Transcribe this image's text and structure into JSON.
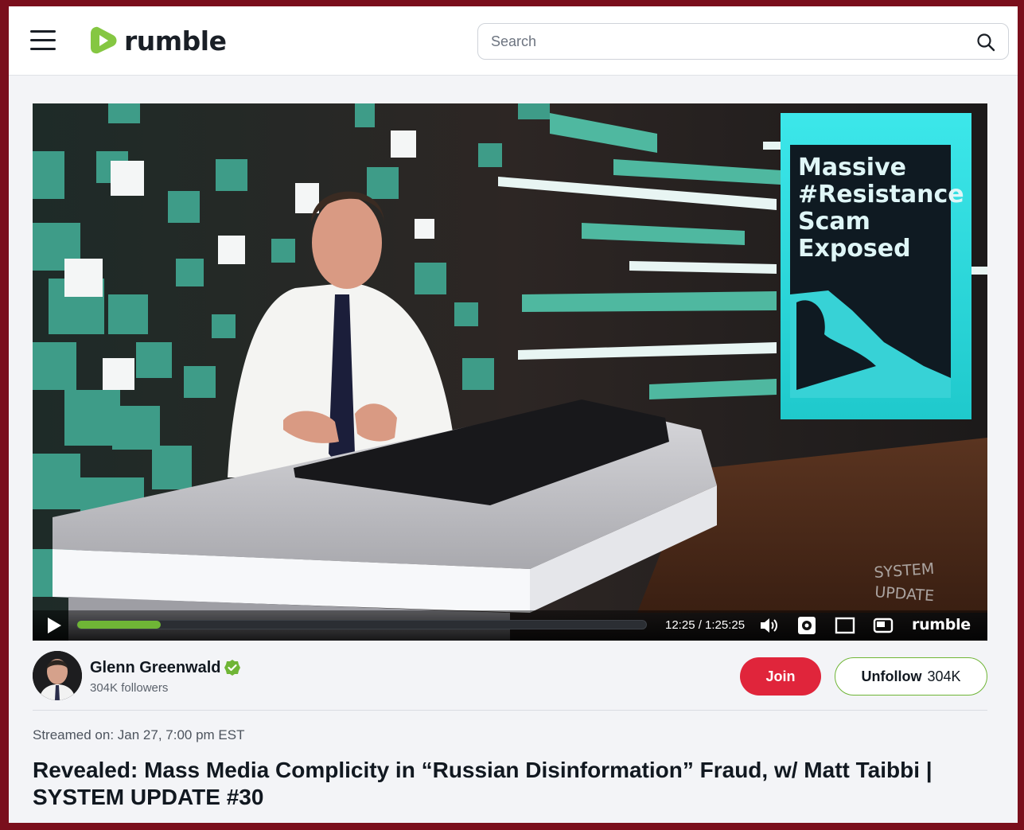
{
  "header": {
    "logo_text": "rumble",
    "search_placeholder": "Search",
    "brand_color": "#85c742"
  },
  "video": {
    "screen_lines": [
      "Massive",
      "#Resistance",
      "Scam",
      "Exposed"
    ],
    "watermark_lines": [
      "SYSTEM",
      "UPDATE"
    ],
    "time_display": "12:25 / 1:25:25",
    "progress_fraction": 0.1462,
    "player_logo": "rumble",
    "icons": [
      "play-icon",
      "volume-icon",
      "settings-icon",
      "theater-mode-icon",
      "fullscreen-icon"
    ]
  },
  "channel": {
    "name": "Glenn Greenwald",
    "followers": "304K followers",
    "join_label": "Join",
    "unfollow_label": "Unfollow",
    "unfollow_count": "304K",
    "accent_red": "#e0253b",
    "accent_green": "#6fb536"
  },
  "meta": {
    "streamed": "Streamed on: Jan 27, 7:00 pm EST",
    "title": "Revealed: Mass Media Complicity in “Russian Disinformation” Fraud, w/ Matt Taibbi | SYSTEM UPDATE #30"
  }
}
